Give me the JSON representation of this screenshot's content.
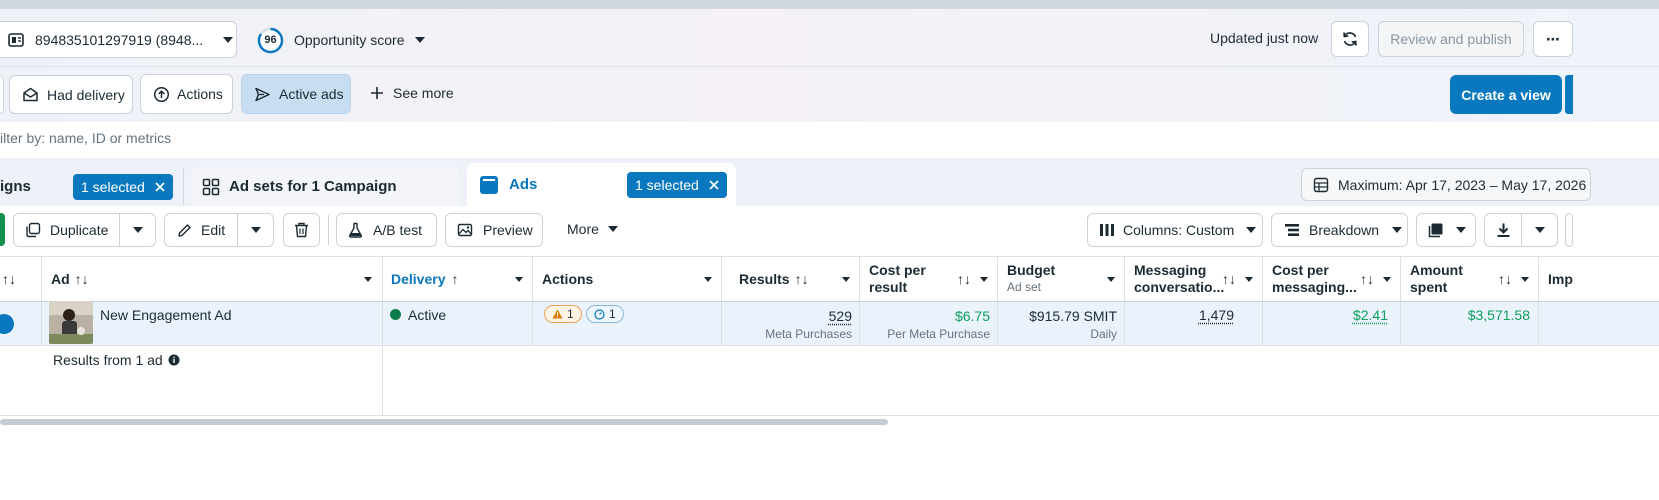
{
  "header": {
    "account_id": "894835101297919 (8948...",
    "opportunity_score_value": "96",
    "opportunity_score_label": "Opportunity score",
    "updated_text": "Updated just now",
    "review_publish_label": "Review and publish",
    "more_label": "⋯"
  },
  "filters": {
    "chips": [
      {
        "label": "Had delivery"
      },
      {
        "label": "Actions"
      },
      {
        "label": "Active ads"
      }
    ],
    "see_more_label": "See more",
    "create_view_label": "Create a view",
    "search_placeholder": "ilter by: name, ID or metrics"
  },
  "tabs": {
    "campaigns_label": "igns",
    "campaigns_badge": "1 selected",
    "adsets_label": "Ad sets for 1 Campaign",
    "ads_label": "Ads",
    "ads_badge": "1 selected",
    "date_range": "Maximum: Apr 17, 2023 – May 17, 2026"
  },
  "toolbar": {
    "duplicate_label": "Duplicate",
    "edit_label": "Edit",
    "ab_test_label": "A/B test",
    "preview_label": "Preview",
    "more_label": "More",
    "columns_label": "Columns: Custom",
    "breakdown_label": "Breakdown"
  },
  "table": {
    "columns": {
      "ad": "Ad",
      "delivery": "Delivery",
      "actions": "Actions",
      "results": "Results",
      "cost_per_result_1": "Cost per",
      "cost_per_result_2": "result",
      "budget": "Budget",
      "budget_sub": "Ad set",
      "messaging_1": "Messaging",
      "messaging_2": "conversatio...",
      "cost_messaging_1": "Cost per",
      "cost_messaging_2": "messaging...",
      "amount_spent_1": "Amount",
      "amount_spent_2": "spent",
      "impressions": "Imp"
    },
    "row": {
      "ad_name": "New Engagement Ad",
      "delivery": "Active",
      "warnings_count": "1",
      "info_count": "1",
      "results_value": "529",
      "results_sub": "Meta Purchases",
      "cost_per_result": "$6.75",
      "cost_per_result_sub": "Per Meta Purchase",
      "budget": "$915.79 SMIT",
      "budget_sub": "Daily",
      "messaging": "1,479",
      "cost_messaging": "$2.41",
      "amount_spent": "$3,571.58"
    },
    "summary": "Results from 1 ad"
  },
  "colors": {
    "accent": "#0a78be",
    "active_green": "#0e7c4a",
    "money_green": "#0e9f5c",
    "warning_orange": "#e07800"
  }
}
